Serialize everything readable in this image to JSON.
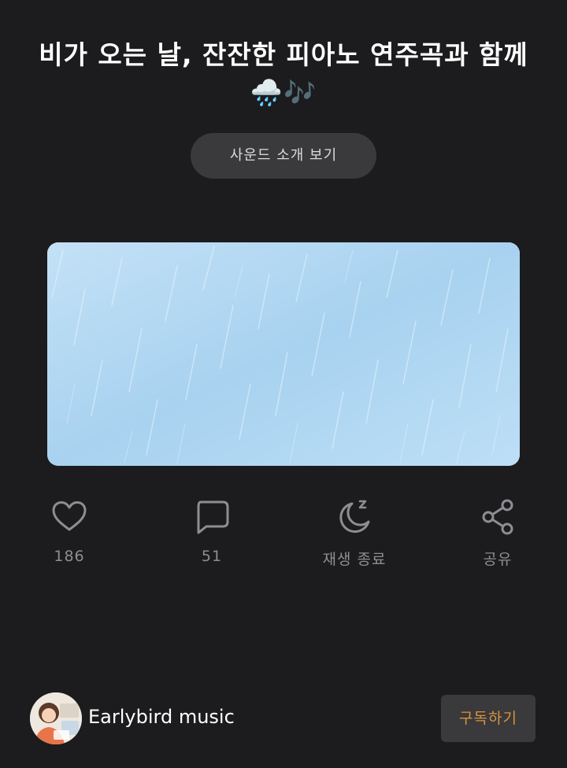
{
  "header": {
    "title": "비가 오는 날, 잔잔한 피아노 연주곡과 함께🌧️🎶"
  },
  "intro_button": {
    "label": "사운드 소개 보기"
  },
  "artwork": {
    "description_icon": "rain-artwork"
  },
  "actions": {
    "like": {
      "icon": "heart-icon",
      "count": "186"
    },
    "comment": {
      "icon": "comment-icon",
      "count": "51"
    },
    "sleep_timer": {
      "icon": "moon-sleep-icon",
      "label": "재생 종료"
    },
    "share": {
      "icon": "share-icon",
      "label": "공유"
    }
  },
  "channel": {
    "name": "Earlybird music",
    "avatar_icon": "avatar"
  },
  "subscribe": {
    "label": "구독하기"
  },
  "colors": {
    "background": "#1c1b1d",
    "button_bg": "#3a393c",
    "icon_gray": "#8e8d91",
    "accent_orange": "#d9933d",
    "artwork_blue": "#b3d9f3"
  }
}
